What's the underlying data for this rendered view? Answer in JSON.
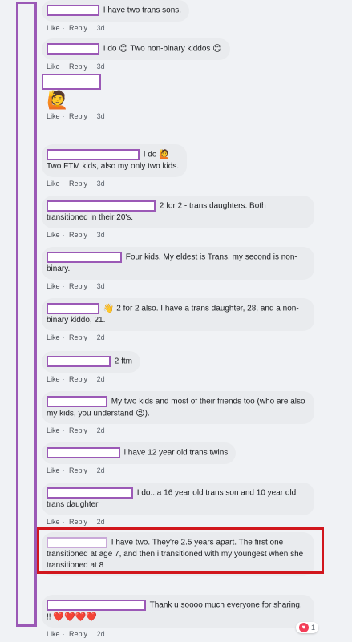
{
  "meta_labels": {
    "like": "Like",
    "reply": "Reply",
    "sep": "·"
  },
  "comments": [
    {
      "text": "I have two trans sons.",
      "time": "3d"
    },
    {
      "text_a": "I do",
      "text_b": "Two non-binary kiddos",
      "time": "3d"
    },
    {
      "time": "3d"
    },
    {
      "text_a": "I do",
      "text_b": "Two FTM kids, also my only two kids.",
      "time": "3d"
    },
    {
      "text": "2 for 2 - trans daughters. Both transitioned in their 20's.",
      "time": "3d"
    },
    {
      "text": "Four kids. My eldest is Trans, my second is non-binary.",
      "time": "3d"
    },
    {
      "text": "2 for 2 also. I have a trans daughter, 28, and a non-binary kiddo, 21.",
      "time": "2d"
    },
    {
      "text": "2 ftm",
      "time": "2d"
    },
    {
      "text_a": "My two kids and most of their friends too (who are also my kids, you understand",
      "text_b": ").",
      "time": "2d"
    },
    {
      "text": "i have 12 year old trans twins",
      "time": "2d"
    },
    {
      "text": "I do...a 16 year old trans son and 10 year old trans daughter",
      "time": "2d"
    },
    {
      "text": "I have two. They're 2.5 years apart. The first one transitioned at age 7, and then i transitioned with my youngest when she transitioned at 8",
      "time": "2d"
    },
    {
      "text": "Thank u soooo much everyone for sharing. !!",
      "time": "2d"
    }
  ],
  "reaction": {
    "count": "1"
  }
}
